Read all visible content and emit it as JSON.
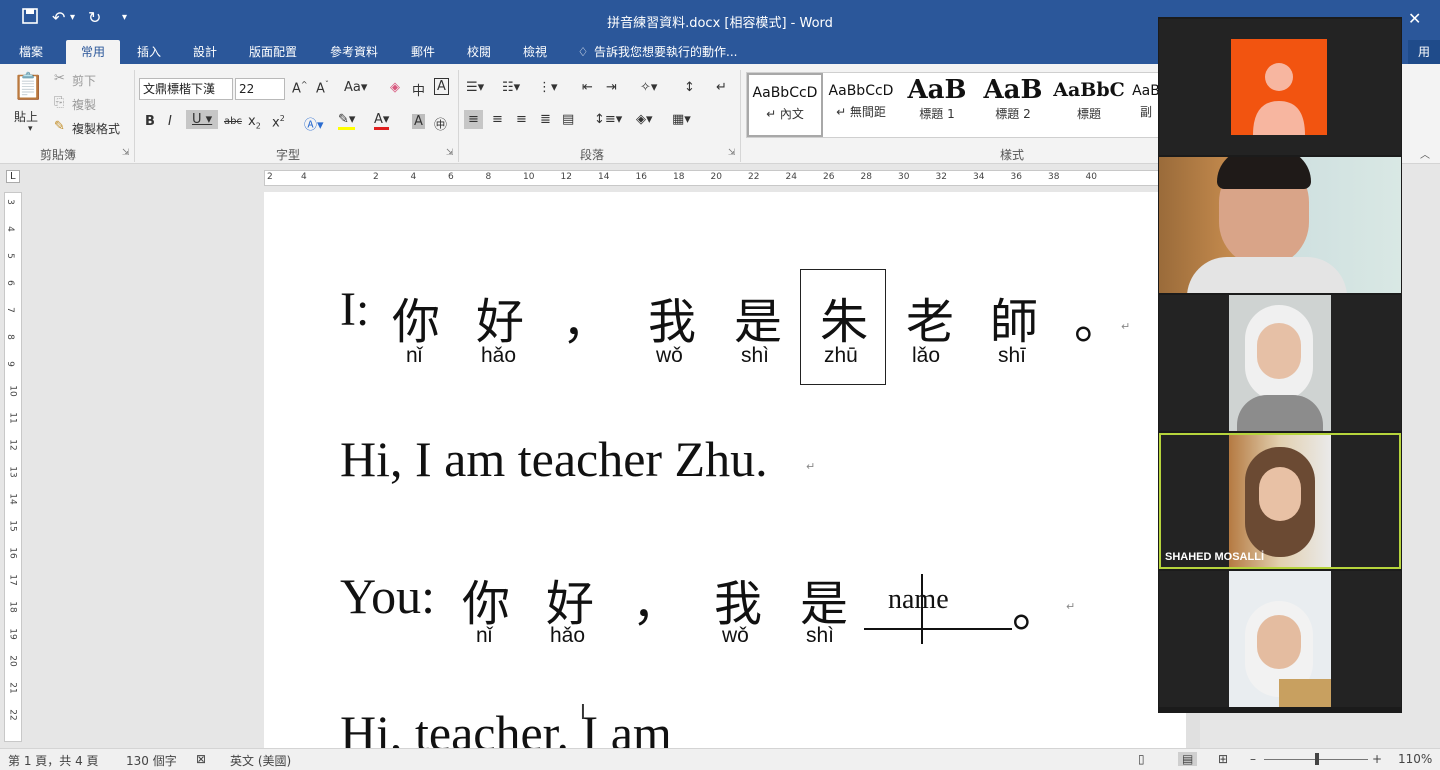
{
  "window": {
    "title": "拼音練習資料.docx [相容模式] - Word"
  },
  "tabs": [
    "檔案",
    "常用",
    "插入",
    "設計",
    "版面配置",
    "參考資料",
    "郵件",
    "校閱",
    "檢視"
  ],
  "tell_me": "告訴我您想要執行的動作...",
  "share_label": "用",
  "ribbon": {
    "clipboard": {
      "paste": "貼上",
      "cut": "剪下",
      "copy": "複製",
      "format_painter": "複製格式",
      "group": "剪貼簿"
    },
    "font": {
      "name": "文鼎標楷下漢",
      "size": "22",
      "group": "字型"
    },
    "paragraph": {
      "group": "段落"
    },
    "styles": {
      "group": "樣式",
      "items": [
        {
          "preview": "AaBbCcD",
          "name": "↵ 內文"
        },
        {
          "preview": "AaBbCcD",
          "name": "↵ 無間距"
        },
        {
          "preview": "AaB",
          "name": "標題 1"
        },
        {
          "preview": "AaB",
          "name": "標題 2"
        },
        {
          "preview": "AaBbC",
          "name": "標題"
        },
        {
          "preview": "AaB",
          "name": "副"
        }
      ]
    }
  },
  "ruler": {
    "ticks": [
      "2",
      "4",
      "2",
      "4",
      "6",
      "8",
      "10",
      "12",
      "14",
      "16",
      "18",
      "20",
      "22",
      "24",
      "26",
      "28",
      "30",
      "32",
      "34",
      "36",
      "38",
      "40"
    ]
  },
  "vruler": {
    "ticks": [
      "3",
      "4",
      "5",
      "6",
      "7",
      "8",
      "9",
      "10",
      "11",
      "12",
      "13",
      "14",
      "15",
      "16",
      "17",
      "18",
      "19",
      "20",
      "21",
      "22"
    ]
  },
  "document": {
    "line1": {
      "prefix": "I:",
      "chars": [
        {
          "han": "你",
          "py": "nǐ"
        },
        {
          "han": "好",
          "py": "hǎo"
        },
        {
          "han": "，",
          "py": ""
        },
        {
          "han": "我",
          "py": "wǒ"
        },
        {
          "han": "是",
          "py": "shì"
        },
        {
          "han": "朱",
          "py": "zhū"
        },
        {
          "han": "老",
          "py": "lǎo"
        },
        {
          "han": "師",
          "py": "shī"
        },
        {
          "han": "。",
          "py": ""
        }
      ]
    },
    "line2": "Hi, I am teacher Zhu.",
    "line3": {
      "prefix": "You:",
      "chars": [
        {
          "han": "你",
          "py": "nǐ"
        },
        {
          "han": "好",
          "py": "hǎo"
        },
        {
          "han": "，",
          "py": ""
        },
        {
          "han": "我",
          "py": "wǒ"
        },
        {
          "han": "是",
          "py": "shì"
        }
      ],
      "blank": "name",
      "end": "。"
    },
    "line4": "Hi, teacher. I am"
  },
  "status": {
    "page": "第 1 頁，共 4 頁",
    "words": "130 個字",
    "lang": "英文 (美國)",
    "zoom": "110%"
  },
  "participants": [
    {
      "name": ""
    },
    {
      "name": ""
    },
    {
      "name": ""
    },
    {
      "name": "SHAHED MOSALLİ"
    },
    {
      "name": ""
    }
  ],
  "colors": {
    "word_blue": "#2b579a",
    "avatar_orange": "#f25410",
    "active_border": "#b6d43c"
  }
}
